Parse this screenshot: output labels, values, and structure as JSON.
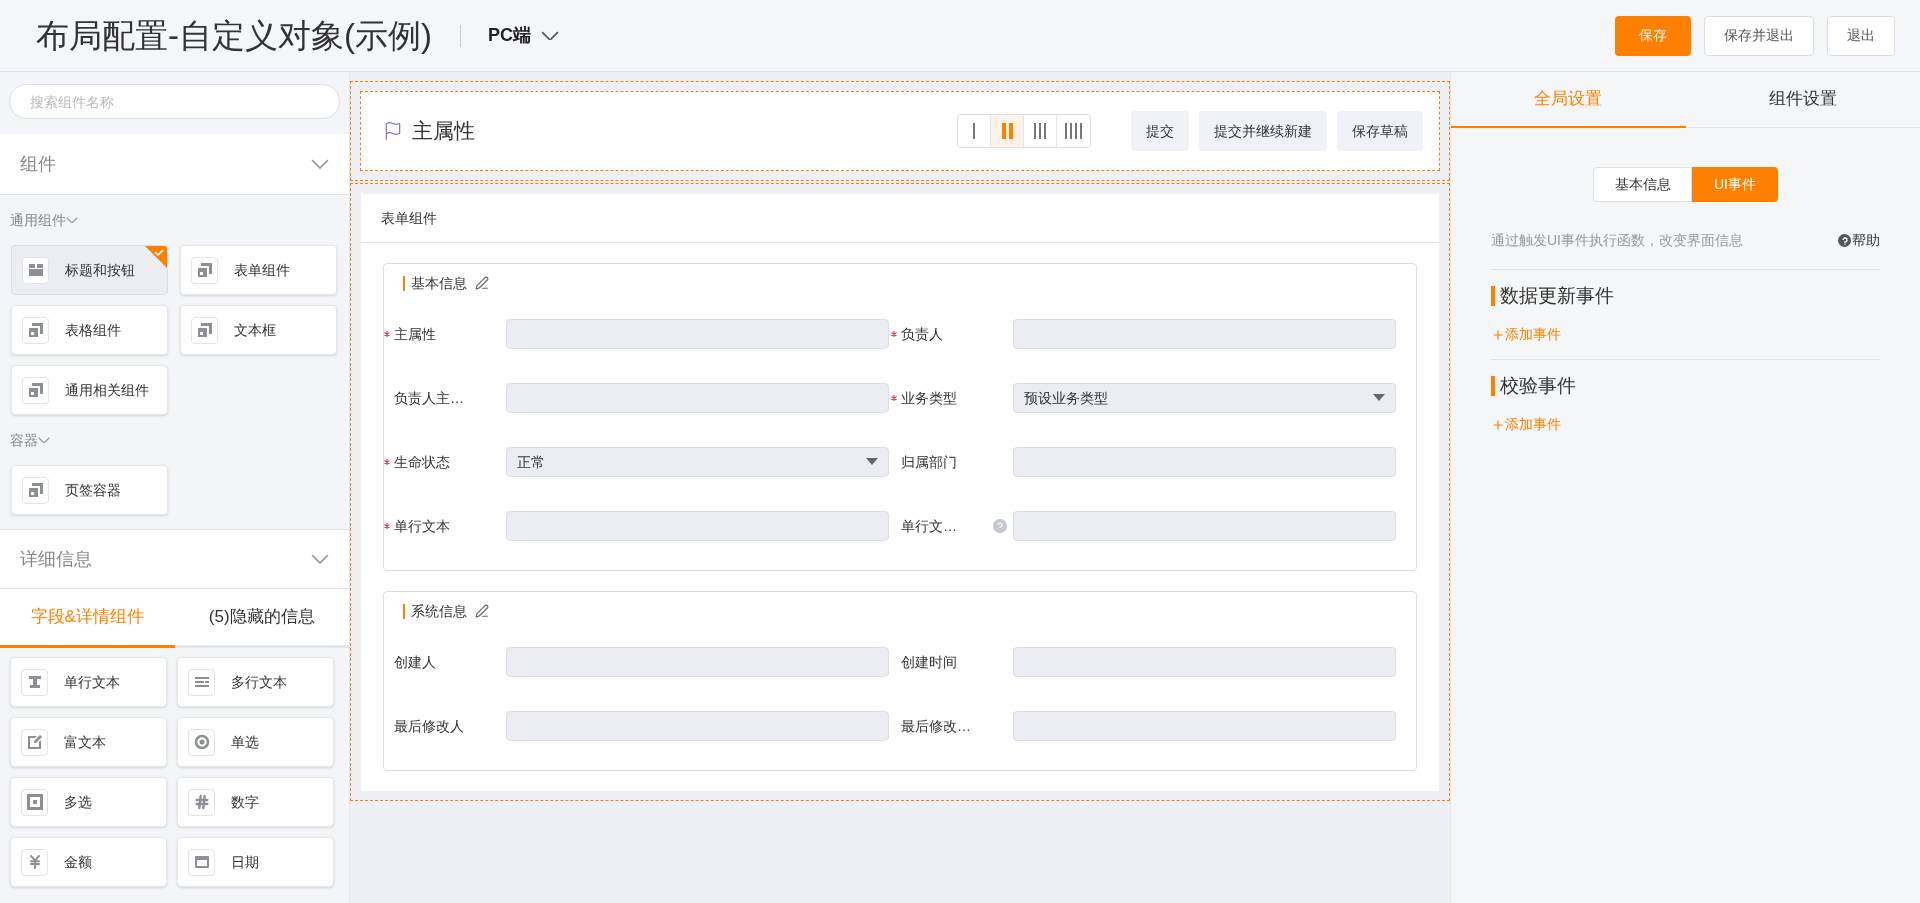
{
  "header": {
    "title": "布局配置-自定义对象(示例)",
    "device": "PC端",
    "buttons": [
      {
        "label": "保存",
        "primary": true
      },
      {
        "label": "保存并退出",
        "primary": false
      },
      {
        "label": "退出",
        "primary": false
      }
    ]
  },
  "left_panel": {
    "search": {
      "placeholder": "搜索组件名称"
    },
    "components": {
      "title": "组件",
      "groups": [
        {
          "title": "通用组件",
          "items": [
            {
              "label": "标题和按钮",
              "kind": "layout",
              "selected": true
            },
            {
              "label": "表单组件",
              "kind": "component",
              "selected": false
            },
            {
              "label": "表格组件",
              "kind": "component",
              "selected": false
            },
            {
              "label": "文本框",
              "kind": "component",
              "selected": false
            },
            {
              "label": "通用相关组件",
              "kind": "component",
              "selected": false
            }
          ]
        },
        {
          "title": "容器",
          "items": [
            {
              "label": "页签容器",
              "kind": "component",
              "selected": false
            }
          ]
        }
      ]
    },
    "details": {
      "title": "详细信息",
      "tabs": [
        {
          "label": "字段&详情组件",
          "selected": true
        },
        {
          "label": "(5)隐藏的信息",
          "selected": false
        }
      ],
      "fields": [
        {
          "label": "单行文本",
          "kind": "text"
        },
        {
          "label": "多行文本",
          "kind": "multiline"
        },
        {
          "label": "富文本",
          "kind": "rich"
        },
        {
          "label": "单选",
          "kind": "radio"
        },
        {
          "label": "多选",
          "kind": "checkbox"
        },
        {
          "label": "数字",
          "kind": "number"
        },
        {
          "label": "金额",
          "kind": "money"
        },
        {
          "label": "日期",
          "kind": "date"
        }
      ]
    }
  },
  "canvas": {
    "title_block": {
      "title": "主属性",
      "layout_options": [
        {
          "selected": false
        },
        {
          "selected": true
        },
        {
          "selected": false
        },
        {
          "selected": false
        }
      ],
      "buttons": [
        "提交",
        "提交并继续新建",
        "保存草稿"
      ]
    },
    "form": {
      "title": "表单组件",
      "sections": [
        {
          "title": "基本信息",
          "fields": [
            {
              "label": "主属性",
              "required": true,
              "kind": "text"
            },
            {
              "label": "负责人",
              "required": true,
              "kind": "text"
            },
            {
              "label": "负责人主…",
              "required": false,
              "kind": "text"
            },
            {
              "label": "业务类型",
              "required": true,
              "kind": "select",
              "value": "预设业务类型"
            },
            {
              "label": "生命状态",
              "required": true,
              "kind": "select",
              "value": "正常"
            },
            {
              "label": "归属部门",
              "required": false,
              "kind": "text"
            },
            {
              "label": "单行文本",
              "required": true,
              "kind": "text"
            },
            {
              "label": "单行文…",
              "required": false,
              "kind": "text",
              "help": true
            }
          ]
        },
        {
          "title": "系统信息",
          "fields": [
            {
              "label": "创建人",
              "required": false,
              "kind": "text"
            },
            {
              "label": "创建时间",
              "required": false,
              "kind": "text"
            },
            {
              "label": "最后修改人",
              "required": false,
              "kind": "text"
            },
            {
              "label": "最后修改…",
              "required": false,
              "kind": "text"
            }
          ]
        }
      ]
    }
  },
  "right_panel": {
    "tabs": [
      {
        "label": "全局设置",
        "selected": true
      },
      {
        "label": "组件设置",
        "selected": false
      }
    ],
    "segments": [
      {
        "label": "基本信息",
        "selected": false
      },
      {
        "label": "UI事件",
        "selected": true
      }
    ],
    "description": "通过触发UI事件执行函数，改变界面信息",
    "help": "帮助",
    "event_groups": [
      {
        "title": "数据更新事件",
        "add": "添加事件"
      },
      {
        "title": "校验事件",
        "add": "添加事件"
      }
    ]
  }
}
